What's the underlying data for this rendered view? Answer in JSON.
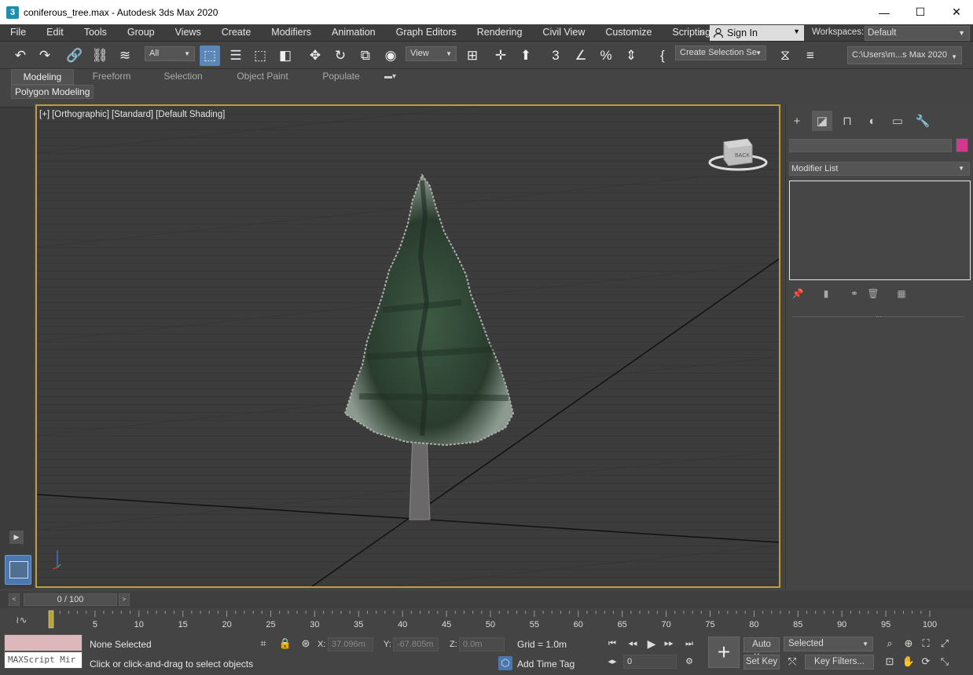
{
  "window": {
    "app_icon_text": "3",
    "title": "coniferous_tree.max - Autodesk 3ds Max 2020",
    "minimize": "—",
    "maximize": "☐",
    "close": "✕"
  },
  "menu": [
    "File",
    "Edit",
    "Tools",
    "Group",
    "Views",
    "Create",
    "Modifiers",
    "Animation",
    "Graph Editors",
    "Rendering",
    "Civil View",
    "Customize",
    "Scripting"
  ],
  "menu_overflow": "»",
  "account": {
    "sign_in": "Sign In",
    "workspaces_label": "Workspaces:",
    "workspace": "Default"
  },
  "toolbar": {
    "selection_filter": "All",
    "ref_coord": "View",
    "named_selection": "Create Selection Se",
    "project_path": "C:\\Users\\m...s Max 2020"
  },
  "ribbon": {
    "tabs": [
      "Modeling",
      "Freeform",
      "Selection",
      "Object Paint",
      "Populate"
    ],
    "active_tab": "Modeling",
    "panel": "Polygon Modeling"
  },
  "viewport": {
    "labels": [
      "[+]",
      "[Orthographic]",
      "[Standard]",
      "[Default Shading]"
    ],
    "viewcube_label": "BACK",
    "accent_border": "#c19b3c"
  },
  "command_panel": {
    "modifier_list": "Modifier List",
    "object_color": "#d3388e"
  },
  "timeline": {
    "slider": "0 / 100",
    "prev": "<",
    "next": ">",
    "ticks": [
      "5",
      "10",
      "15",
      "20",
      "25",
      "30",
      "35",
      "40",
      "45",
      "50",
      "55",
      "60",
      "65",
      "70",
      "75",
      "80",
      "85",
      "90",
      "95",
      "100"
    ],
    "current_frame": 0
  },
  "status": {
    "maxscript_mini": "MAXScript Mir",
    "selection": "None Selected",
    "prompt": "Click or click-and-drag to select objects",
    "x_label": "X:",
    "x_value": "37.096m",
    "y_label": "Y:",
    "y_value": "-67.805m",
    "z_label": "Z:",
    "z_value": "0.0m",
    "grid": "Grid = 1.0m",
    "add_time_tag": "Add Time Tag"
  },
  "anim_controls": {
    "auto_key": "Auto Key",
    "set_key": "Set Key",
    "key_mode": "Selected",
    "key_filters": "Key Filters...",
    "frame": "0"
  }
}
